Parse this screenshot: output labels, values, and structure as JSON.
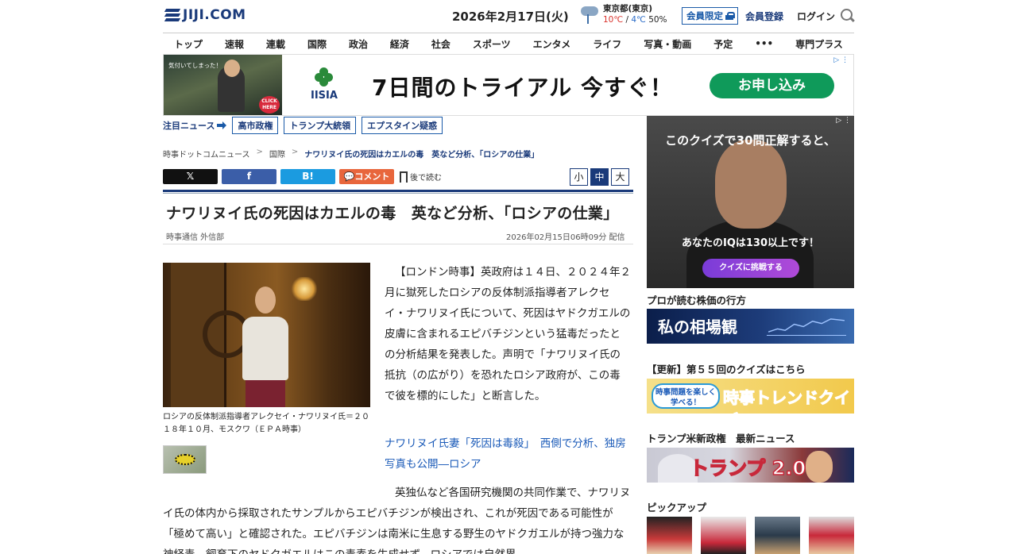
{
  "header": {
    "logo": "JIJI.COM",
    "date": "2026年2月17日(火)",
    "weather": {
      "place": "東京都(東京)",
      "high": "10℃",
      "sep": " / ",
      "low": "4℃",
      "rain": " 50%"
    },
    "member_only": "会員限定",
    "register": "会員登録",
    "login": "ログイン"
  },
  "nav": [
    "トップ",
    "速報",
    "連載",
    "国際",
    "政治",
    "経済",
    "社会",
    "スポーツ",
    "エンタメ",
    "ライフ",
    "写真・動画",
    "予定",
    "•••",
    "専門プラス"
  ],
  "ad_top": {
    "caption": "気付いてしまった！",
    "click": "CLICK HERE",
    "brand": "IISIA",
    "headline": "7日間のトライアル 今すぐ！",
    "cta": "お申し込み"
  },
  "hot": {
    "label": "注目ニュース",
    "tags": [
      "高市政権",
      "トランプ大統領",
      "エプスタイン疑惑"
    ]
  },
  "breadcrumb": {
    "home": "時事ドットコムニュース",
    "sep": ">",
    "section": "国際",
    "current": "ナワリヌイ氏の死因はカエルの毒　英など分析、「ロシアの仕業」"
  },
  "share": {
    "x": "𝕏",
    "fb": "f",
    "hb": "B!",
    "comment": "コメント",
    "later": "後で読む"
  },
  "fontsize": [
    "小",
    "中",
    "大"
  ],
  "article": {
    "title": "ナワリヌイ氏の死因はカエルの毒　英など分析、「ロシアの仕業」",
    "byline": "時事通信 外信部",
    "timestamp": "2026年02月15日06時09分 配信",
    "photo_caption": "ロシアの反体制派指導者アレクセイ・ナワリヌイ氏＝２０１８年１０月、モスクワ（ＥＰＡ時事）",
    "para1": "【ロンドン時事】英政府は１４日、２０２４年２月に獄死したロシアの反体制派指導者アレクセイ・ナワリヌイ氏について、死因はヤドクガエルの皮膚に含まれるエピバチジンという猛毒だったとの分析結果を発表した。声明で「ナワリヌイ氏の抵抗（の広がり）を恐れたロシア政府が、この毒で彼を標的にした」と断言した。",
    "related_link": "ナワリヌイ氏妻「死因は毒殺」　西側で分析、独房写真も公開―ロシア",
    "para2": "英独仏など各国研究機関の共同作業で、ナワリヌイ氏の体内から採取されたサンプルからエピバチジンが検出され、これが死因である可能性が「極めて高い」と確認された。エピバチジンは南米に生息する野生のヤドクガエルが持つ強力な神経毒。飼育下のヤドクガエルはこの毒素を生成せず、ロシアでは自然界"
  },
  "sidebar": {
    "ad": {
      "text1": "このクイズで30問正解すると、",
      "text2": "あなたのIQは130以上です！",
      "button": "クイズに挑戦する"
    },
    "market_head": "プロが読む株価の行方",
    "market_banner": "私の相場観",
    "quiz_head": "【更新】第５５回のクイズはこちら",
    "quiz_bubble": "時事問題を楽しく学べる！",
    "quiz_banner": "時事トレンドクイズ",
    "trump_head": "トランプ米新政権　最新ニュース",
    "trump_banner": "トランプ 2.0",
    "pickup_head": "ピックアップ"
  }
}
